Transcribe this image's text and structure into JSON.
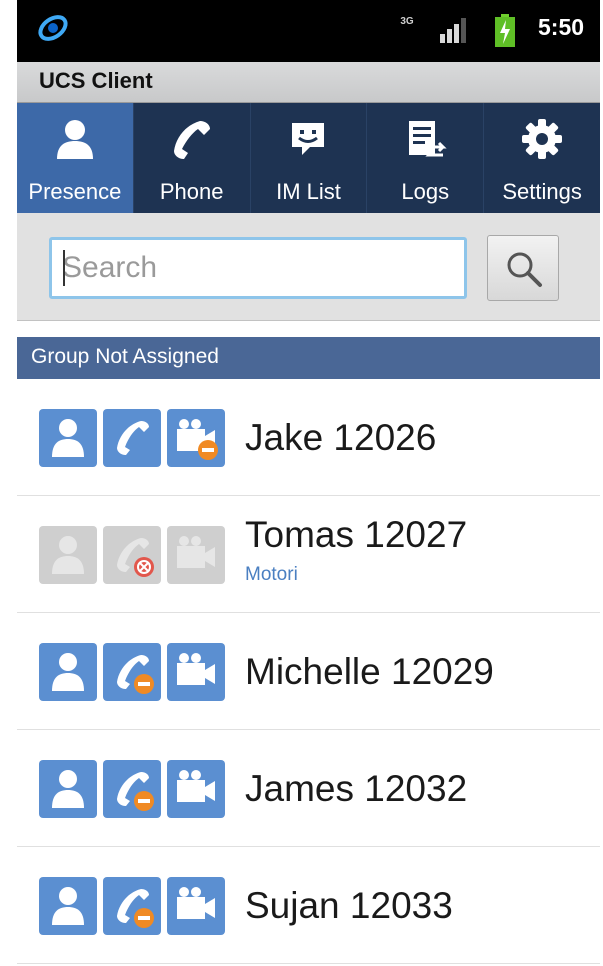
{
  "status_bar": {
    "network": "3G",
    "time": "5:50"
  },
  "title_bar": {
    "title": "UCS Client"
  },
  "tabs": [
    {
      "label": "Presence",
      "icon": "person-icon",
      "active": true
    },
    {
      "label": "Phone",
      "icon": "phone-icon",
      "active": false
    },
    {
      "label": "IM List",
      "icon": "chat-icon",
      "active": false
    },
    {
      "label": "Logs",
      "icon": "logs-icon",
      "active": false
    },
    {
      "label": "Settings",
      "icon": "gear-icon",
      "active": false
    }
  ],
  "search": {
    "placeholder": "Search",
    "value": ""
  },
  "group": {
    "name": "Group Not Assigned"
  },
  "contacts": [
    {
      "name": "Jake 12026",
      "subtitle": "",
      "presence": "online",
      "phone": "available",
      "video": "busy"
    },
    {
      "name": "Tomas 12027",
      "subtitle": "Motori",
      "presence": "offline",
      "phone": "unavailable",
      "video": "offline"
    },
    {
      "name": "Michelle 12029",
      "subtitle": "",
      "presence": "online",
      "phone": "busy",
      "video": "available"
    },
    {
      "name": "James 12032",
      "subtitle": "",
      "presence": "online",
      "phone": "busy",
      "video": "available"
    },
    {
      "name": "Sujan 12033",
      "subtitle": "",
      "presence": "online",
      "phone": "busy",
      "video": "available"
    }
  ],
  "colors": {
    "tab_bar": "#1e3352",
    "active_tab": "#3d69a8",
    "group_header": "#4a6796",
    "icon_active": "#5b8fd1",
    "busy_badge": "#f08a24",
    "blocked_badge": "#e2574c"
  }
}
